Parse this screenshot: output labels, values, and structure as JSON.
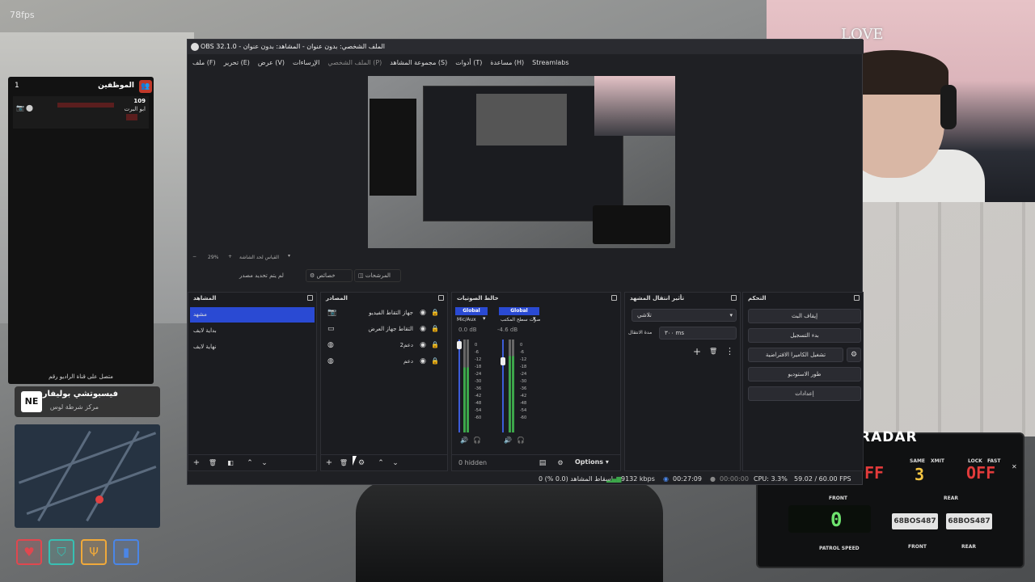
{
  "overlay": {
    "fps": "78fps"
  },
  "employees": {
    "title": "الموظفين",
    "count": "1",
    "number": "109",
    "name": "ابو البرت",
    "footer": "متصل على قناة الراديو رقم"
  },
  "location_card": {
    "badge": "NE",
    "title": "فيسبوتشي بوليفارد",
    "subtitle": "مركز شرطة لوس"
  },
  "hud_icons": [
    {
      "name": "heart-icon",
      "glyph": "♥",
      "color": "#e0474f"
    },
    {
      "name": "shield-icon",
      "glyph": "⛉",
      "color": "#37c0b3"
    },
    {
      "name": "food-icon",
      "glyph": "🍴",
      "color": "#f0a93a"
    },
    {
      "name": "drink-icon",
      "glyph": "▮",
      "color": "#4a86e8"
    }
  ],
  "webcam": {
    "sign": "LOVE"
  },
  "radar": {
    "title": "RADAR",
    "same_label": "SAME",
    "xmit_label": "XMIT",
    "lock_label": "LOCK",
    "fast_label": "FAST",
    "front_value": "FF",
    "same_value": "3",
    "off_value": "OFF",
    "front_label": "FRONT",
    "rear_label": "REAR",
    "patrol_value": "0",
    "patrol_label": "PATROL SPEED",
    "plate_front": "68BOS487",
    "plate_rear": "68BOS487",
    "front_bottom": "FRONT",
    "rear_bottom": "REAR"
  },
  "obs": {
    "title": "OBS 32.1.0 - الملف الشخصي: بدون عنوان - المشاهد: بدون عنوان",
    "menu": [
      "ملف (F)",
      "تحرير (E)",
      "عرض (V)",
      "الإرساءات",
      "الملف الشخصي (P)",
      "مجموعة المشاهد (S)",
      "أدوات (T)",
      "مساعدة (H)",
      "Streamlabs"
    ],
    "zoom": "29%",
    "scale_label": "القياس لحد الشاشة",
    "no_source": "لم يتم تحديد مصدر",
    "properties_tab": "خصائص",
    "filters_tab": "المرشحات",
    "docks": {
      "scenes": {
        "title": "المشاهد",
        "items": [
          "مشهد",
          "بداية لايف",
          "نهاية لايف"
        ]
      },
      "sources": {
        "title": "المصادر",
        "items": [
          {
            "label": "جهاز التقاط الفيديو",
            "icon": "camera-icon"
          },
          {
            "label": "التقاط جهاز العرض",
            "icon": "monitor-icon"
          },
          {
            "label": "دعم2",
            "icon": "globe-icon"
          },
          {
            "label": "دعم",
            "icon": "globe-icon"
          }
        ]
      },
      "mixer": {
        "title": "خالط الصوتيات",
        "ch1_tag": "Global",
        "ch2_tag": "Global",
        "ch1_name": "Mic/Aux",
        "ch2_name": "صوت سطح المكتب",
        "ch1_db": "0.0 dB",
        "ch2_db": "-4.6 dB",
        "ticks": [
          "0",
          "-6",
          "-12",
          "-18",
          "-24",
          "-30",
          "-36",
          "-42",
          "-48",
          "-54",
          "-60"
        ],
        "hidden": "0 hidden",
        "options": "Options"
      },
      "transitions": {
        "title": "تأثير انتقال المشهد",
        "selected": "تلاشي",
        "duration_label": "مدة الانتقال",
        "duration": "٣٠٠ ms"
      },
      "controls": {
        "title": "التحكم",
        "buttons": [
          "إيقاف البث",
          "بدء التسجيل",
          "تشغيل الكاميرا الافتراضية",
          "طور الاستوديو",
          "إعدادات"
        ]
      }
    },
    "status": {
      "dropped": "إسقاط المشاهد (0.0 %) 0",
      "bitrate": "9132 kbps",
      "stream_time": "00:27:09",
      "rec_time": "00:00:00",
      "cpu": "CPU: 3.3%",
      "fps": "59.02 / 60.00 FPS"
    }
  }
}
